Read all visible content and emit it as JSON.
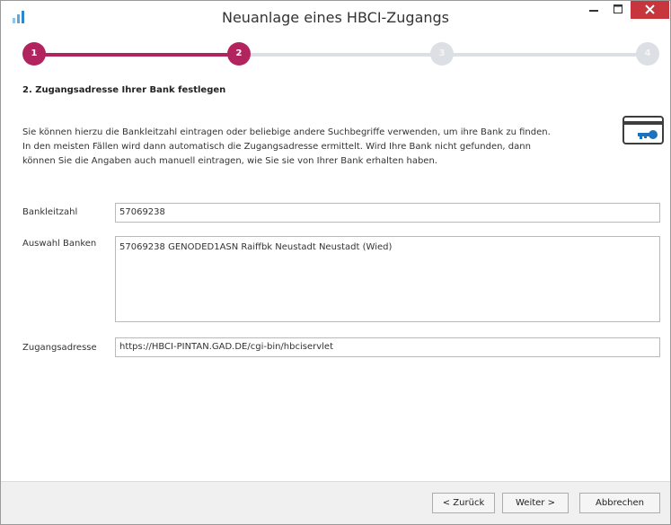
{
  "window": {
    "title": "Neuanlage eines HBCI-Zugangs",
    "controls": {
      "minimize": "–",
      "maximize": "□",
      "close": "✕"
    }
  },
  "stepper": {
    "steps": [
      {
        "label": "1",
        "state": "completed"
      },
      {
        "label": "2",
        "state": "current"
      },
      {
        "label": "3",
        "state": "pending"
      },
      {
        "label": "4",
        "state": "pending"
      }
    ],
    "active_color": "#b2245e",
    "inactive_color": "#dcdfe3"
  },
  "section": {
    "title": "2. Zugangsadresse Ihrer Bank festlegen",
    "description_lines": [
      "Sie können hierzu die Bankleitzahl eintragen oder beliebige andere Suchbegriffe verwenden, um ihre Bank zu finden.",
      "In den meisten Fällen wird dann automatisch die Zugangsadresse ermittelt. Wird Ihre Bank nicht gefunden, dann",
      "können Sie die Angaben auch manuell eintragen, wie Sie sie von Ihrer Bank erhalten haben."
    ],
    "icon": "bank-card-key-icon"
  },
  "form": {
    "bankleitzahl": {
      "label": "Bankleitzahl",
      "value": "57069238"
    },
    "auswahl_banken": {
      "label": "Auswahl Banken",
      "items": [
        "57069238 GENODED1ASN Raiffbk Neustadt Neustadt (Wied)"
      ]
    },
    "zugangsadresse": {
      "label": "Zugangsadresse",
      "value": "https://HBCI-PINTAN.GAD.DE/cgi-bin/hbciservlet"
    }
  },
  "footer": {
    "back_label": "< Zurück",
    "next_label": "Weiter >",
    "cancel_label": "Abbrechen"
  }
}
